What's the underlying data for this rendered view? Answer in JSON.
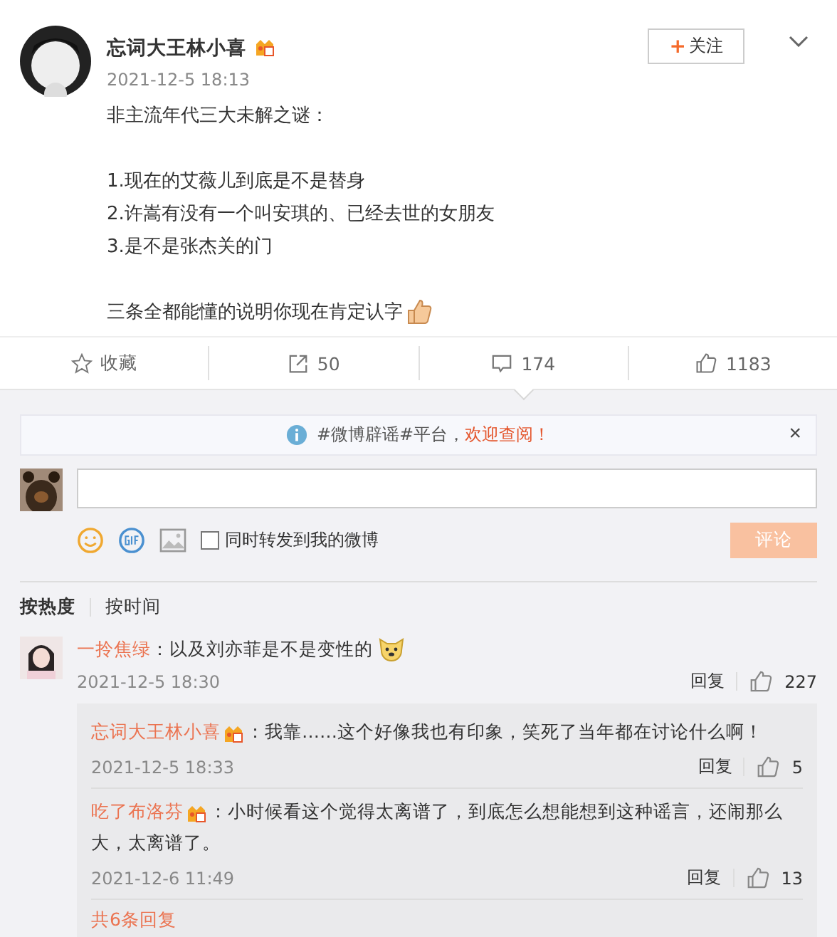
{
  "post": {
    "author": "忘词大王林小喜",
    "badge": true,
    "time": "2021-12-5 18:13",
    "follow_label": "关注",
    "follow_icon": "+",
    "paragraphs": [
      [
        "非主流年代三大未解之谜："
      ],
      [
        "1.现在的艾薇儿到底是不是替身",
        "2.许嵩有没有一个叫安琪的、已经去世的女朋友",
        "3.是不是张杰关的门"
      ],
      [
        "三条全都能懂的说明你现在肯定认字"
      ]
    ],
    "emoji": {
      "kind": "thumb"
    }
  },
  "actions": [
    {
      "kind": "star",
      "label": "收藏",
      "selected": false
    },
    {
      "kind": "share",
      "label": "50",
      "selected": false
    },
    {
      "kind": "comment",
      "label": "174",
      "selected": true
    },
    {
      "kind": "like",
      "label": "1183",
      "selected": false
    }
  ],
  "notice": {
    "text": "#微博辟谣#平台，",
    "link": "欢迎查阅！",
    "close": "×"
  },
  "composer": {
    "checkbox_label": "同时转发到我的微博",
    "checked": false,
    "submit": "评论",
    "disabled": true
  },
  "sort_tabs": [
    {
      "label": "按热度",
      "selected": true
    },
    {
      "label": "按时间",
      "selected": false
    }
  ],
  "comments": [
    {
      "user": "一拎焦绿",
      "badge": false,
      "text": "：以及刘亦菲是不是变性的",
      "emoji": {
        "kind": "dog"
      },
      "time": "2021-12-5 18:30",
      "reply": "回复",
      "likes": "227",
      "children": [
        {
          "user": "忘词大王林小喜",
          "badge": true,
          "text": "：我靠……这个好像我也有印象，笑死了当年都在讨论什么啊！",
          "time": "2021-12-5 18:33",
          "reply": "回复",
          "likes": "5"
        },
        {
          "user": "吃了布洛芬",
          "badge": true,
          "text": "：小时候看这个觉得太离谱了，到底怎么想能想到这种谣言，还闹那么大，太离谱了。",
          "time": "2021-12-6 11:49",
          "reply": "回复",
          "likes": "13"
        }
      ],
      "more_replies": "共6条回复"
    }
  ]
}
